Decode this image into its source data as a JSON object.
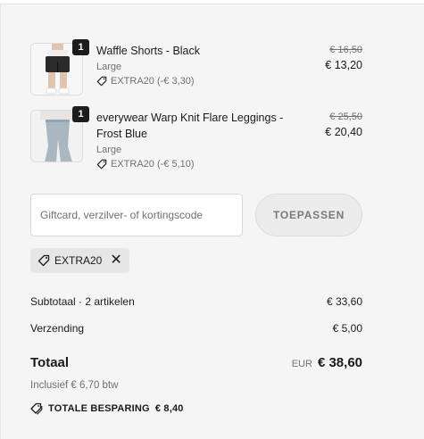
{
  "items": [
    {
      "quantity": "1",
      "name": "Waffle Shorts - Black",
      "variant": "Large",
      "discount": "EXTRA20 (-€ 3,30)",
      "original_price": "€ 16,50",
      "price": "€ 13,20",
      "image": "black shorts on model"
    },
    {
      "quantity": "1",
      "name": "everywear Warp Knit Flare Leggings - Frost Blue",
      "variant": "Large",
      "discount": "EXTRA20 (-€ 5,10)",
      "original_price": "€ 25,50",
      "price": "€ 20,40",
      "image": "frost blue flare leggings on model"
    }
  ],
  "discount_code": {
    "placeholder": "Giftcard, verzilver- of kortingscode",
    "value": "",
    "apply_label": "TOEPASSEN"
  },
  "applied_tag": {
    "code": "EXTRA20",
    "remove_glyph": "✕"
  },
  "summary": {
    "subtotal_label": "Subtotaal · 2 artikelen",
    "subtotal_value": "€ 33,60",
    "shipping_label": "Verzending",
    "shipping_value": "€ 5,00",
    "total_label": "Totaal",
    "currency": "EUR",
    "total_value": "€ 38,60",
    "tax_note": "Inclusief € 6,70 btw",
    "savings_label": "TOTALE BESPARING",
    "savings_value": "€ 8,40"
  },
  "icons": {
    "discount": "tag-icon",
    "remove": "close-icon",
    "savings": "tags-icon"
  }
}
